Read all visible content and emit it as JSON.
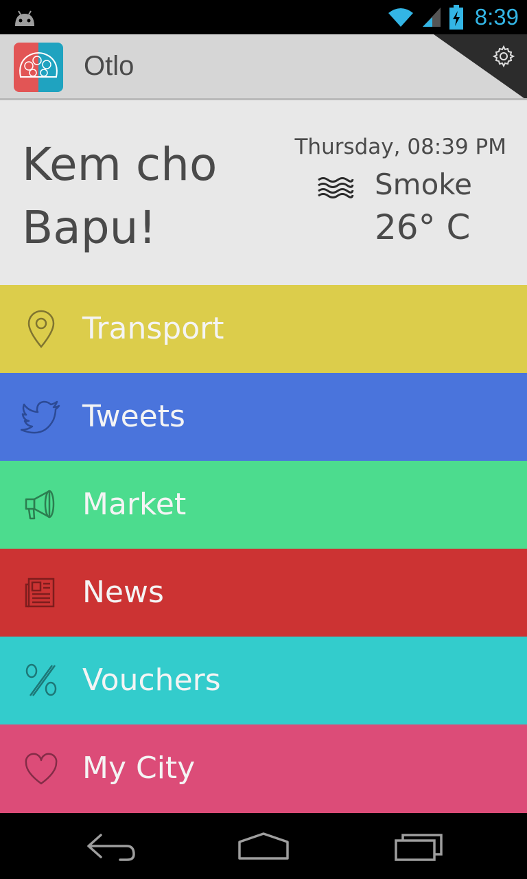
{
  "status_bar": {
    "time": "8:39"
  },
  "app": {
    "title": "Otlo"
  },
  "hero": {
    "greeting_line1": "Kem cho",
    "greeting_line2": "Bapu!",
    "datetime": "Thursday, 08:39 PM",
    "condition": "Smoke",
    "temperature": "26° C"
  },
  "menu": {
    "items": [
      {
        "label": "Transport",
        "icon": "location-pin-icon",
        "color": "#dccd4b",
        "icon_color": "#7f7430"
      },
      {
        "label": "Tweets",
        "icon": "twitter-bird-icon",
        "color": "#4a74dc",
        "icon_color": "#2c4a95"
      },
      {
        "label": "Market",
        "icon": "megaphone-icon",
        "color": "#4cdc8e",
        "icon_color": "#2c7d50"
      },
      {
        "label": "News",
        "icon": "newspaper-icon",
        "color": "#cc3333",
        "icon_color": "#7d1d1d"
      },
      {
        "label": "Vouchers",
        "icon": "percent-icon",
        "color": "#33cccc",
        "icon_color": "#1d7777"
      },
      {
        "label": "My City",
        "icon": "heart-icon",
        "color": "#dc4c78",
        "icon_color": "#842c47"
      }
    ]
  },
  "colors": {
    "status_accent": "#33b5e5",
    "action_bar": "#d6d6d6",
    "hero_bg": "#e8e8e8",
    "text_dark": "#4a4a4a"
  }
}
